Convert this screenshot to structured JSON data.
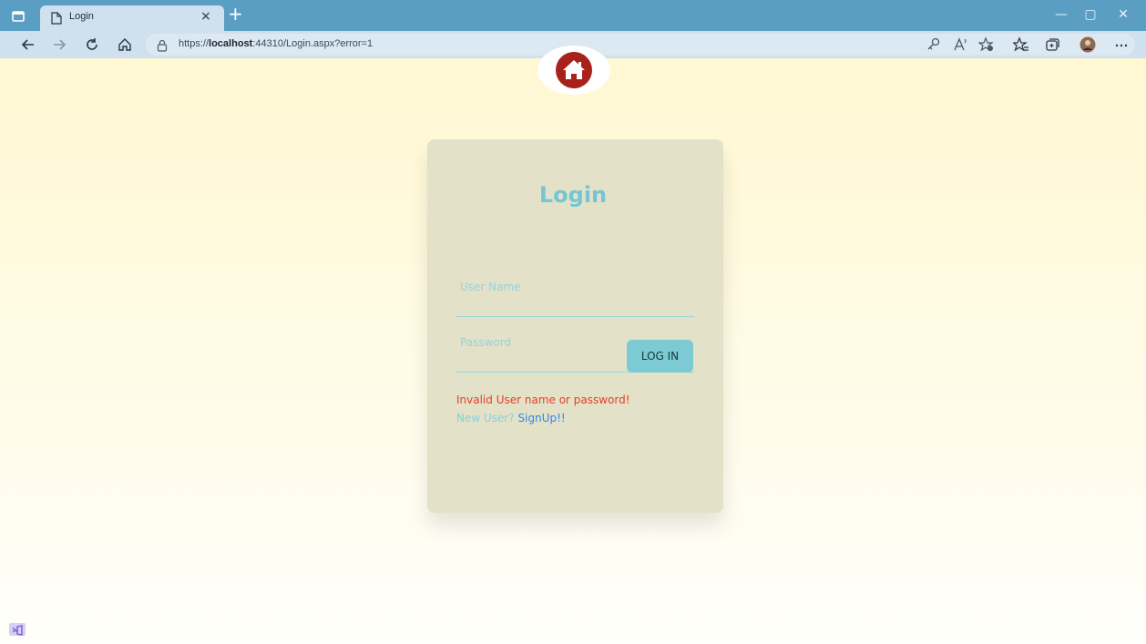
{
  "browser": {
    "tab_title": "Login",
    "tab_close_glyph": "×",
    "new_tab_glyph": "+",
    "url_prefix": "https://",
    "url_host": "localhost",
    "url_rest": ":44310/Login.aspx?error=1",
    "window_controls": {
      "minimize": "—",
      "restore": "▢",
      "close": "✕"
    },
    "icons": [
      "sidebar-icon",
      "tab-page-icon",
      "back-arrow-icon",
      "forward-arrow-icon",
      "refresh-icon",
      "home-icon",
      "lock-icon",
      "key-icon",
      "read-aloud-icon",
      "favorites-add-icon",
      "favorites-icon",
      "collections-icon",
      "profile-icon",
      "more-icon"
    ]
  },
  "login": {
    "title": "Login",
    "username_label": "User Name",
    "username_value": "",
    "password_label": "Password",
    "password_value": "",
    "button_label": "LOG IN",
    "error_message": "Invalid User name or password!",
    "signup_prefix": "New User?",
    "signup_link": "SignUp!!"
  },
  "colors": {
    "accent": "#74c6d4",
    "button": "#7ccbd4",
    "error": "#e63d2b",
    "link": "#2f86e8",
    "house_icon": "#a7221a"
  }
}
